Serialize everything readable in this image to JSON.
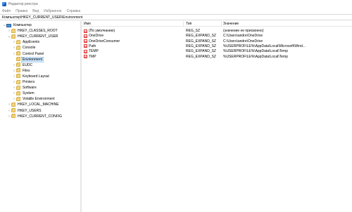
{
  "window": {
    "title": "Редактор реестра"
  },
  "menu": [
    "Файл",
    "Правка",
    "Вид",
    "Избранное",
    "Справка"
  ],
  "address": "Компьютер\\HKEY_CURRENT_USER\\Environment",
  "tree": [
    {
      "label": "Компьютер",
      "chevron": "v",
      "icon": "computer",
      "selected": false
    },
    {
      "label": "HKEY_CLASSES_ROOT",
      "chevron": ">",
      "icon": "folder",
      "selected": false
    },
    {
      "label": "HKEY_CURRENT_USER",
      "chevron": "v",
      "icon": "folder",
      "selected": false
    },
    {
      "label": "AppEvents",
      "chevron": ">",
      "icon": "folder",
      "selected": false
    },
    {
      "label": "Console",
      "chevron": ">",
      "icon": "folder",
      "selected": false
    },
    {
      "label": "Control Panel",
      "chevron": ">",
      "icon": "folder",
      "selected": false
    },
    {
      "label": "Environment",
      "chevron": "",
      "icon": "folder",
      "selected": true
    },
    {
      "label": "EUDC",
      "chevron": ">",
      "icon": "folder",
      "selected": false
    },
    {
      "label": "Files",
      "chevron": ">",
      "icon": "folder",
      "selected": false
    },
    {
      "label": "Keyboard Layout",
      "chevron": ">",
      "icon": "folder",
      "selected": false
    },
    {
      "label": "Printers",
      "chevron": ">",
      "icon": "folder",
      "selected": false
    },
    {
      "label": "Software",
      "chevron": ">",
      "icon": "folder",
      "selected": false
    },
    {
      "label": "System",
      "chevron": ">",
      "icon": "folder",
      "selected": false
    },
    {
      "label": "Volatile Environment",
      "chevron": ">",
      "icon": "folder",
      "selected": false
    },
    {
      "label": "HKEY_LOCAL_MACHINE",
      "chevron": ">",
      "icon": "folder",
      "selected": false
    },
    {
      "label": "HKEY_USERS",
      "chevron": ">",
      "icon": "folder",
      "selected": false
    },
    {
      "label": "HKEY_CURRENT_CONFIG",
      "chevron": ">",
      "icon": "folder",
      "selected": false
    }
  ],
  "columns": {
    "name": "Имя",
    "type": "Тип",
    "data": "Значение"
  },
  "values": [
    {
      "name": "(По умолчанию)",
      "type": "REG_SZ",
      "data": "(значение не присвоено)"
    },
    {
      "name": "OneDrive",
      "type": "REG_EXPAND_SZ",
      "data": "C:\\Users\\andre\\OneDrive"
    },
    {
      "name": "OneDriveConsumer",
      "type": "REG_EXPAND_SZ",
      "data": "C:\\Users\\andre\\OneDrive"
    },
    {
      "name": "Path",
      "type": "REG_EXPAND_SZ",
      "data": "%USERPROFILE%\\AppData\\Local\\Microsoft\\Wind..."
    },
    {
      "name": "TEMP",
      "type": "REG_EXPAND_SZ",
      "data": "%USERPROFILE%\\AppData\\Local\\Temp"
    },
    {
      "name": "TMP",
      "type": "REG_EXPAND_SZ",
      "data": "%USERPROFILE%\\AppData\\Local\\Temp"
    }
  ],
  "value_icon": "ab",
  "colors": {
    "selection": "#cce8ff",
    "folder": "#f3d37a"
  }
}
